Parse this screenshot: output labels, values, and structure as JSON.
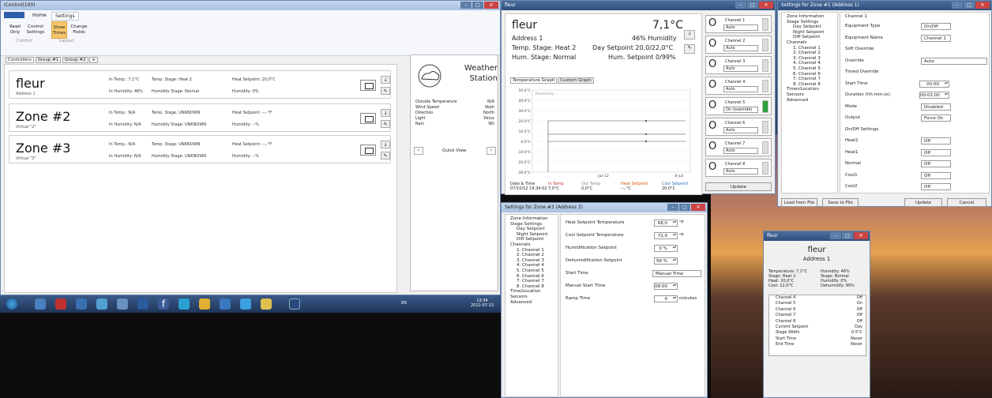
{
  "main_window": {
    "title": "iControl(100)",
    "ribbon_tabs": [
      "Home",
      "Settings"
    ],
    "ribbon_buttons": [
      {
        "label": "Read Only"
      },
      {
        "label": "Control Settings"
      },
      {
        "label": "Show Times"
      },
      {
        "label": "Change Fields"
      }
    ],
    "ribbon_groups": [
      "Control",
      "Layout"
    ],
    "view_tabs": [
      "Controllers",
      "Group #1",
      "Group #2",
      "+"
    ],
    "zones": [
      {
        "name": "fleur",
        "addr": "Address 1",
        "in_temp": "In Temp.: 7,1°C",
        "in_hum": "In Humidity: 46%",
        "temp_stage": "Temp. Stage: Heat 2",
        "hum_stage": "Humidity Stage: Normal",
        "heat_sp": "Heat Setpoint: 20,0°C",
        "humidity": "Humidity: 0%"
      },
      {
        "name": "Zone #2",
        "addr": "Virtual \"2\"",
        "in_temp": "In Temp.: N/A",
        "in_hum": "In Humidity: N/A",
        "temp_stage": "Temp. Stage: UNKNOWN",
        "hum_stage": "Humidity Stage: UNKNOWN",
        "heat_sp": "Heat Setpoint: --,-°F",
        "humidity": "Humidity: --%"
      },
      {
        "name": "Zone #3",
        "addr": "Virtual \"3\"",
        "in_temp": "In Temp.: N/A",
        "in_hum": "In Humidity: N/A",
        "temp_stage": "Temp. Stage: UNKNOWN",
        "hum_stage": "Humidity Stage: UNKNOWN",
        "heat_sp": "Heat Setpoint: --,-°F",
        "humidity": "Humidity: --%"
      }
    ],
    "weather": {
      "title": "Weather Station",
      "rows": [
        {
          "k": "Outside Temperature",
          "v": "N/A"
        },
        {
          "k": "Wind Speed",
          "v": "0kph"
        },
        {
          "k": "Direction",
          "v": "North"
        },
        {
          "k": "Light",
          "v": "0klux"
        },
        {
          "k": "Rain",
          "v": "NO"
        }
      ],
      "quick_view": "Quick View"
    }
  },
  "taskbar": {
    "lang": "EN",
    "time": "13:34",
    "date": "2012-07-13"
  },
  "zone_window": {
    "title": "fleur",
    "name": "fleur",
    "temp": "7,1°C",
    "address": "Address 1",
    "humidity": "46% Humidity",
    "temp_stage": "Temp. Stage: Heat 2",
    "day_setpoint": "Day Setpoint 20,0/22,0°C",
    "hum_stage": "Hum. Stage: Normal",
    "hum_setpoint": "Hum. Setpoint 0/99%",
    "graph_tabs": [
      "Temperature Graph",
      "Custom Graph"
    ],
    "graph_note": "Powered by ...",
    "y_ticks": [
      "50.0°C",
      "40.0°C",
      "30.0°C",
      "20.0°C",
      "10.0°C",
      "0.0°C",
      "-10.0°C",
      "-20.0°C",
      "-30.0°C"
    ],
    "x_ticks": [
      "juil 12",
      "8 juil"
    ],
    "legend_headers": [
      "Date & Time",
      "In Temp",
      "Out Temp",
      "Heat Setpoint",
      "Cool Setpoint"
    ],
    "legend_values": [
      "07/10/12 19:34:02",
      "7,0°C",
      "0,0°C",
      "--,-°C",
      "20,0°C"
    ],
    "channels": [
      {
        "label": "Channel 1",
        "value": "Auto",
        "on": false
      },
      {
        "label": "Channel 2",
        "value": "Auto",
        "on": false
      },
      {
        "label": "Channel 3",
        "value": "Auto",
        "on": false
      },
      {
        "label": "Channel 4",
        "value": "Auto",
        "on": false
      },
      {
        "label": "Channel 5",
        "value": "On (override)",
        "on": true
      },
      {
        "label": "Channel 6",
        "value": "Auto",
        "on": false
      },
      {
        "label": "Channel 7",
        "value": "Auto",
        "on": false
      },
      {
        "label": "Channel 8",
        "value": "Auto",
        "on": false
      }
    ],
    "update": "Update"
  },
  "settings1": {
    "title": "Settings for Zone #1 (Address 1)",
    "tree": [
      "Zone Information",
      "Stage Settings",
      "Day Setpoint",
      "Night Setpoint",
      "Diff Setpoint",
      "Channels",
      "1. Channel 1",
      "2. Channel 2",
      "3. Channel 3",
      "4. Channel 4",
      "5. Channel 5",
      "6. Channel 6",
      "7. Channel 7",
      "8. Channel 8",
      "Timer/Location",
      "Sensors",
      "Advanced"
    ],
    "header": "Channel 1",
    "fields": [
      {
        "k": "Equipment Type",
        "v": "On/Off"
      },
      {
        "k": "Equipment Name",
        "v": "Channel 1"
      },
      {
        "k": "Soft Override",
        "v": ""
      },
      {
        "k": "Override",
        "v": "Auto"
      },
      {
        "k": "Timed Override",
        "v": ""
      },
      {
        "k": "Start Time",
        "v": "00:00"
      },
      {
        "k": "Duration (hh:mm:ss)",
        "v": "00:02:00"
      },
      {
        "k": "Mode",
        "v": "Disabled"
      },
      {
        "k": "Output",
        "v": "Force On"
      },
      {
        "k": "On/Off Settings",
        "v": ""
      },
      {
        "k": "Heat2",
        "v": "Off"
      },
      {
        "k": "Heat1",
        "v": "Off"
      },
      {
        "k": "Normal",
        "v": "Off"
      },
      {
        "k": "Cool1",
        "v": "Off"
      },
      {
        "k": "Cool2",
        "v": "Off"
      }
    ],
    "buttons": [
      "Load from File",
      "Save to File",
      "Update",
      "Cancel"
    ]
  },
  "settings3": {
    "title": "Settings for Zone #3 (Address 3)",
    "tree": [
      "Zone Information",
      "Stage Settings",
      "Day Setpoint",
      "Night Setpoint",
      "Diff Setpoint",
      "Channels",
      "1. Channel 1",
      "2. Channel 2",
      "3. Channel 3",
      "4. Channel 4",
      "5. Channel 5",
      "6. Channel 6",
      "7. Channel 7",
      "8. Channel 8",
      "Time/Location",
      "Sensors",
      "Advanced"
    ],
    "fields": [
      {
        "k": "Heat Setpoint Temperature",
        "v": "68,0",
        "u": "°F"
      },
      {
        "k": "Cool Setpoint Temperature",
        "v": "72,0",
        "u": "°F"
      },
      {
        "k": "Humidification Setpoint",
        "v": "0 %",
        "u": ""
      },
      {
        "k": "Dehumidification Setpoint",
        "v": "99 %",
        "u": ""
      },
      {
        "k": "Start Time",
        "v": "Manual Time",
        "u": ""
      },
      {
        "k": "Manual Start Time",
        "v": "08:00",
        "u": ""
      },
      {
        "k": "Ramp Time",
        "v": "0",
        "u": "minutes"
      }
    ]
  },
  "mini_window": {
    "title": "fleur",
    "name": "fleur",
    "address": "Address 1",
    "stats_left": [
      "Temperature: 7,1°C",
      "Stage: Heat 2",
      "Heat: 20,0°C",
      "Cool: 22,0°C"
    ],
    "stats_right": [
      "Humidity: 46%",
      "Stage: Normal",
      "Humidify: 0%",
      "Dehumidify: 99%"
    ],
    "list": [
      {
        "k": "Channel 4",
        "v": "Off"
      },
      {
        "k": "Channel 5",
        "v": "On"
      },
      {
        "k": "Channel 6",
        "v": "Off"
      },
      {
        "k": "Channel 7",
        "v": "Off"
      },
      {
        "k": "Channel 8",
        "v": "Off"
      },
      {
        "k": "Current Setpoint",
        "v": "Day"
      },
      {
        "k": "Stage Width",
        "v": "0,5°C"
      },
      {
        "k": "Start Time",
        "v": "Never"
      },
      {
        "k": "End Time",
        "v": "Never"
      }
    ]
  },
  "chart_data": {
    "type": "line",
    "ylim": [
      -30,
      50
    ],
    "series": [
      {
        "name": "In Temp",
        "values": [
          7,
          7
        ]
      },
      {
        "name": "Out Temp",
        "values": [
          0,
          0
        ]
      },
      {
        "name": "Cool Setpoint",
        "values": [
          20,
          20
        ]
      }
    ],
    "colors": {
      "in": "#c0392b",
      "out": "#7f8c8d",
      "heat": "#d35400",
      "cool": "#2c6fb5"
    }
  }
}
